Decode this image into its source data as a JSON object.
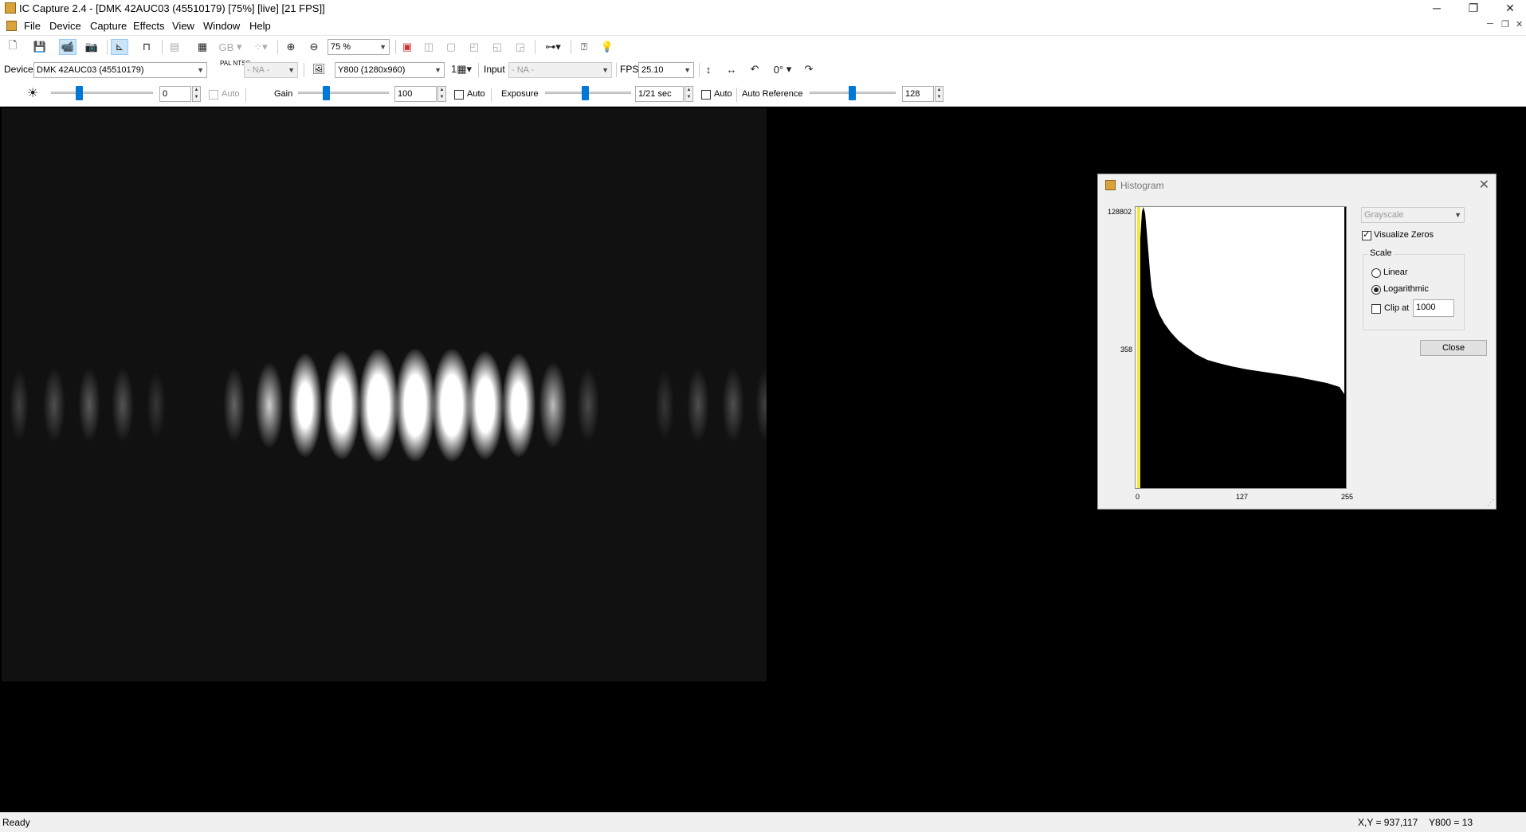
{
  "window": {
    "title": "IC Capture 2.4 - [DMK 42AUC03 (45510179) [75%]  [live]  [21 FPS]]",
    "controls": [
      "─",
      "❐",
      "✕"
    ]
  },
  "menu": {
    "items": [
      "File",
      "Device",
      "Capture",
      "Effects",
      "View",
      "Window",
      "Help"
    ],
    "mdi_controls": [
      "─",
      "❐",
      "✕"
    ]
  },
  "toolbar": {
    "zoom_value": "75 %",
    "gb_label": "GB"
  },
  "device_row": {
    "device_label": "Device",
    "device_value": "DMK 42AUC03 (45510179)",
    "videonorm_value": "- NA -",
    "videonorm_icon": "PAL NTSC",
    "format_value": "Y800 (1280x960)",
    "input_label": "Input",
    "input_value": "- NA -",
    "fps_label": "FPS",
    "fps_value": "25.10",
    "rotation_value": "0°"
  },
  "properties_row": {
    "brightness_value": "0",
    "brightness_auto": "Auto",
    "gain_label": "Gain",
    "gain_value": "100",
    "gain_auto": "Auto",
    "exposure_label": "Exposure",
    "exposure_value": "1/21 sec",
    "exposure_auto": "Auto",
    "autoref_label": "Auto Reference",
    "autoref_value": "128"
  },
  "histogram": {
    "title": "Histogram",
    "channel_value": "Grayscale",
    "visualize_zeros_label": "Visualize Zeros",
    "visualize_zeros_checked": true,
    "scale_group_label": "Scale",
    "linear_label": "Linear",
    "logarithmic_label": "Logarithmic",
    "selected_scale": "Logarithmic",
    "clip_label": "Clip at",
    "clip_value": "1000",
    "close_button": "Close",
    "y_max_label": "128802",
    "y_mid_label": "358",
    "x_labels": [
      "0",
      "127",
      "255"
    ]
  },
  "status": {
    "left": "Ready",
    "coords": "X,Y = 937,117",
    "pixel": "Y800 = 13"
  }
}
